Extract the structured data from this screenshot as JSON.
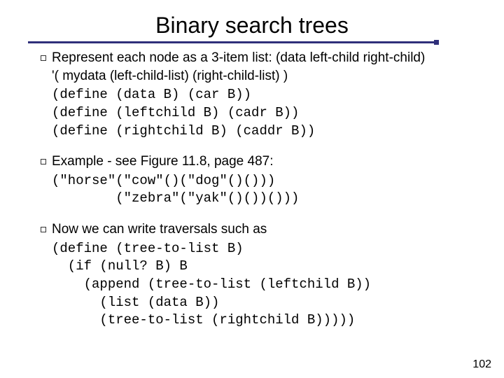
{
  "title": "Binary search trees",
  "items": [
    {
      "text_lines": [
        "Represent each node as a 3-item list: (data left-child right-child)",
        "'( mydata (left-child-list) (right-child-list) )"
      ],
      "code": "(define (data B) (car B))\n(define (leftchild B) (cadr B))\n(define (rightchild B) (caddr B))"
    },
    {
      "text_lines": [
        "Example - see Figure 11.8, page 487:"
      ],
      "code": "(\"horse\"(\"cow\"()(\"dog\"()()))\n        (\"zebra\"(\"yak\"()())()))"
    },
    {
      "text_lines": [
        "Now we can write traversals such as"
      ],
      "code": "(define (tree-to-list B)\n  (if (null? B) B\n    (append (tree-to-list (leftchild B))\n      (list (data B))\n      (tree-to-list (rightchild B)))))"
    }
  ],
  "page_number": "102"
}
